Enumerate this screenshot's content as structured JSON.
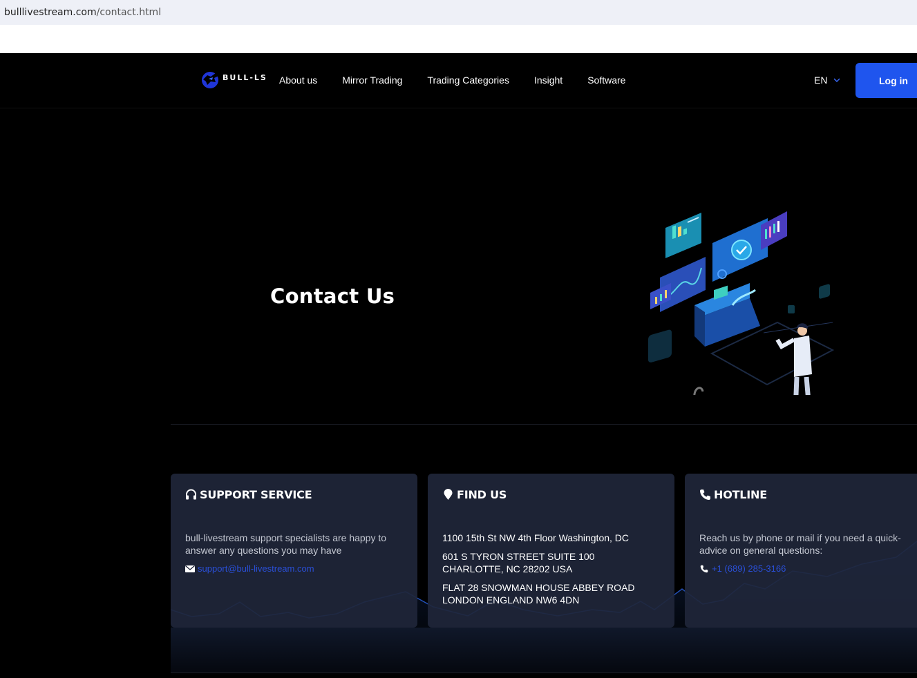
{
  "browser": {
    "url_host": "bulllivestream.com",
    "url_path": "/contact.html"
  },
  "nav": {
    "logo_text": "BULL-LS",
    "links": [
      "About us",
      "Mirror Trading",
      "Trading Categories",
      "Insight",
      "Software"
    ],
    "language": "EN",
    "login_label": "Log in"
  },
  "hero": {
    "title": "Contact Us"
  },
  "cards": {
    "support": {
      "title": "SUPPORT SERVICE",
      "text": "bull-livestream support specialists are happy to answer any questions you may have",
      "email": "support@bull-livestream.com"
    },
    "find": {
      "title": "FIND US",
      "addresses": [
        "1100 15th St NW 4th Floor Washington, DC",
        "601 S TYRON STREET SUITE 100 CHARLOTTE, NC 28202 USA",
        "FLAT 28 SNOWMAN HOUSE ABBEY ROAD LONDON ENGLAND NW6 4DN"
      ]
    },
    "hotline": {
      "title": "HOTLINE",
      "text": "Reach us by phone or mail if you need a quick-advice on general questions:",
      "phone": "+1 (689) 285-3166"
    }
  },
  "colors": {
    "accent": "#1f55ee",
    "card_bg": "#20263a",
    "link": "#2a4fd7"
  }
}
